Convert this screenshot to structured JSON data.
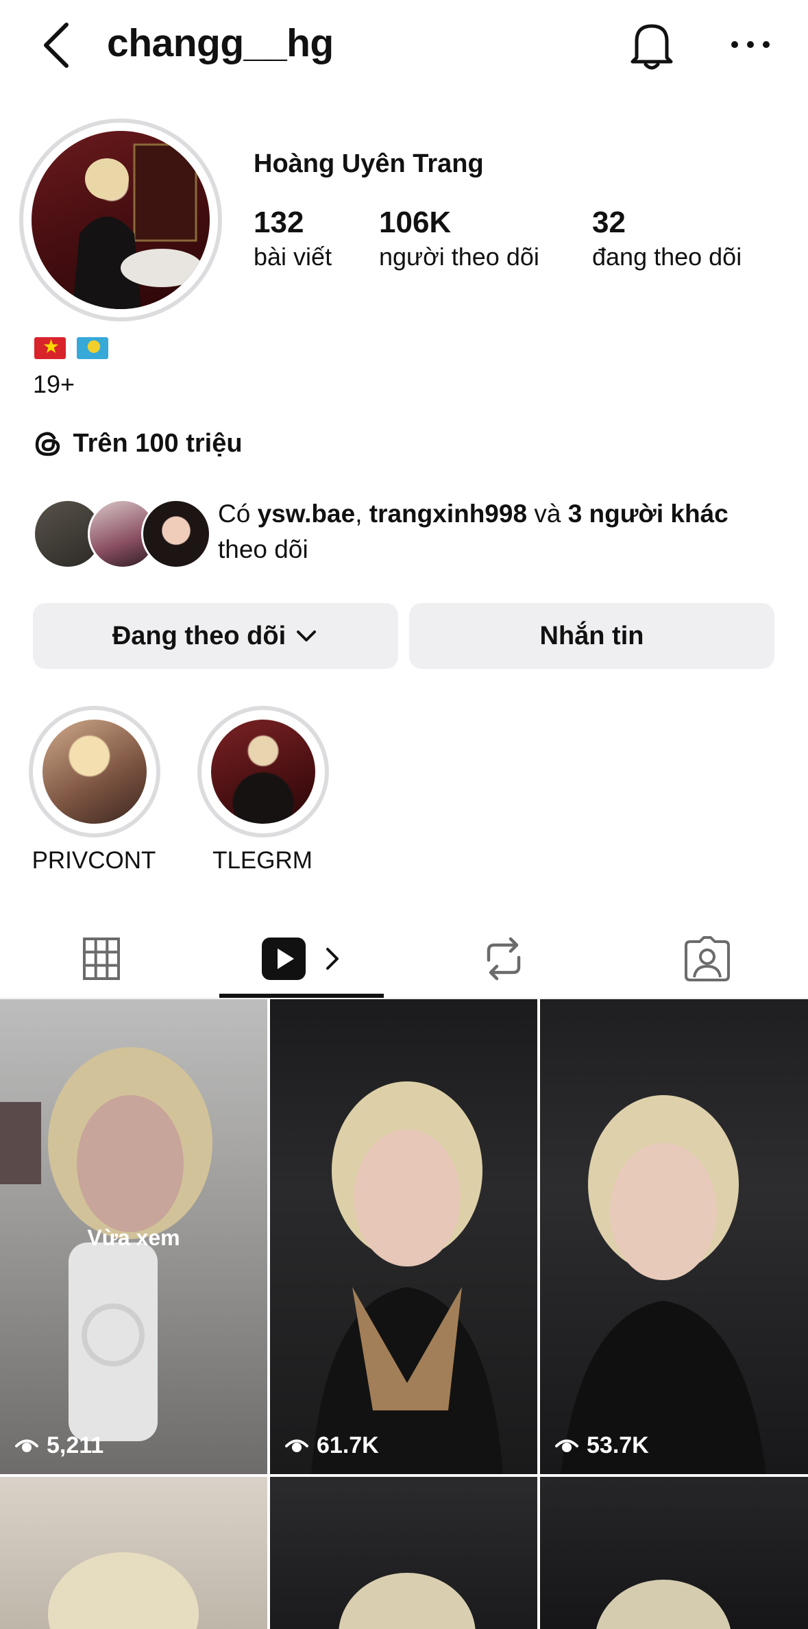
{
  "header": {
    "username": "changg__hg"
  },
  "profile": {
    "display_name": "Hoàng Uyên Trang",
    "stats": [
      {
        "value": "132",
        "label": "bài viết"
      },
      {
        "value": "106K",
        "label": "người theo dõi"
      },
      {
        "value": "32",
        "label": "đang theo dõi"
      }
    ],
    "age": "19+",
    "threads_label": "Trên 100 triệu",
    "mutual": {
      "prefix": "Có ",
      "user1": "ysw.bae",
      "sep": ", ",
      "user2": "trangxinh998",
      "and": " và ",
      "others": "3 người khác",
      "suffix": "theo dõi"
    }
  },
  "actions": {
    "following_label": "Đang theo dõi",
    "message_label": "Nhắn tin"
  },
  "highlights": [
    {
      "label": "PRIVCONT"
    },
    {
      "label": "TLEGRM"
    }
  ],
  "grid": {
    "just_watched_label": "Vừa xem",
    "items": [
      {
        "views": "5,211"
      },
      {
        "views": "61.7K"
      },
      {
        "views": "53.7K"
      }
    ]
  },
  "colors": {
    "button_bg": "#efeff1",
    "ring": "#dcdcdf",
    "text": "#111111"
  }
}
